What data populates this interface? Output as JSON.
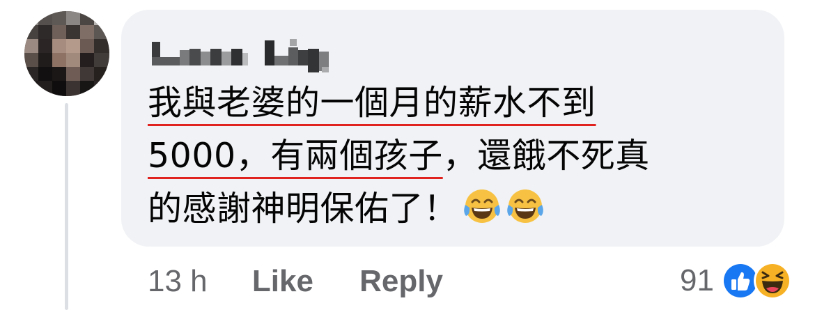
{
  "comment": {
    "author_name": "Lxxxx Lxxg",
    "text_lines": [
      {
        "underlined": "我與老婆的一個月的薪水不到",
        "rest": ""
      },
      {
        "underlined": "5000，有兩個孩子",
        "rest": "，還餓不死真"
      },
      {
        "underlined": "",
        "rest": "的感謝神明保佑了！"
      }
    ],
    "emojis": [
      "face-with-tears-of-joy-icon",
      "face-with-tears-of-joy-icon"
    ]
  },
  "meta": {
    "time": "13 h",
    "like_label": "Like",
    "reply_label": "Reply"
  },
  "reactions": {
    "count": "91",
    "icons": [
      "like-reaction-icon",
      "haha-reaction-icon"
    ],
    "like_color": "#1877f2",
    "haha_color": "#f7b125"
  },
  "colors": {
    "bubble_bg": "#f0f2f5",
    "text": "#050505",
    "secondary_text": "#65676b",
    "annotation_underline": "#e0231f"
  }
}
